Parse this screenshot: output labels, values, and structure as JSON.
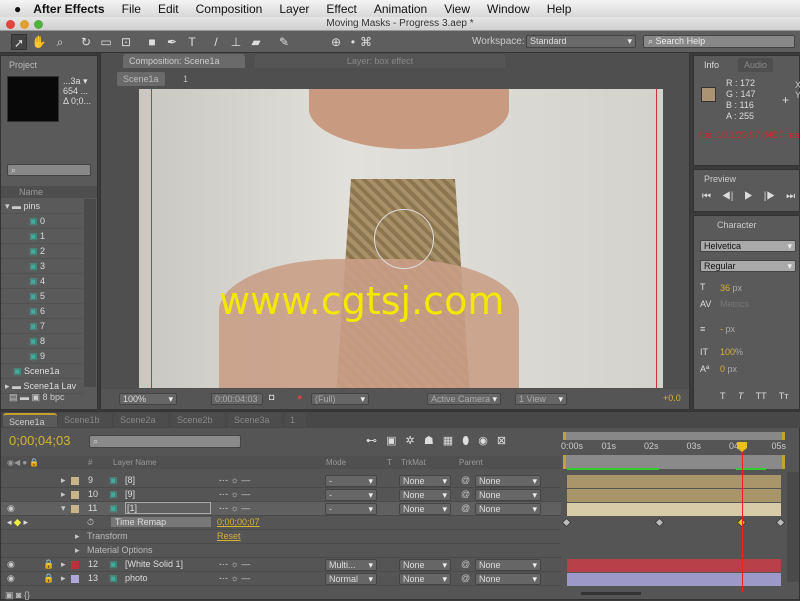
{
  "menubar": {
    "app": "After Effects",
    "items": [
      "File",
      "Edit",
      "Composition",
      "Layer",
      "Effect",
      "Animation",
      "View",
      "Window",
      "Help"
    ]
  },
  "window_title": "Moving Masks - Progress 3.aep *",
  "toolbar": {
    "workspace_label": "Workspace:",
    "workspace_value": "Standard",
    "search_placeholder": "Search Help"
  },
  "project": {
    "tab": "Project",
    "thumb_info": [
      "...3a ▾",
      "654 ...",
      "Δ 0;0..."
    ],
    "column": "Name",
    "items": [
      {
        "name": "pins",
        "type": "folder"
      },
      {
        "name": "0"
      },
      {
        "name": "1"
      },
      {
        "name": "2"
      },
      {
        "name": "3"
      },
      {
        "name": "4"
      },
      {
        "name": "5"
      },
      {
        "name": "6"
      },
      {
        "name": "7"
      },
      {
        "name": "8"
      },
      {
        "name": "9"
      },
      {
        "name": "Scene1a",
        "type": "comp"
      },
      {
        "name": "Scene1a Lav",
        "type": "folder"
      }
    ],
    "bpc": "8 bpc"
  },
  "composition": {
    "tab": "Composition: Scene1a",
    "layer_tab": "Layer: box effect",
    "breadcrumb": "Scene1a",
    "breadcrumb_next": "1",
    "watermark": "www.cgtsj.com",
    "footer": {
      "zoom": "100%",
      "timecode": "0:00:04:03",
      "resolution": "(Full)",
      "camera": "Active Camera",
      "views": "1 View",
      "exposure": "+0.0"
    }
  },
  "info": {
    "tab": "Info",
    "tab2": "Audio",
    "R": "R : 172",
    "G": "G : 147",
    "B": "B : 116",
    "A": "A : 255",
    "X": "X",
    "Y": "Y",
    "fps": "fps: 10.1/29.97 (NOT realtime)",
    "swatch": "#ac9374"
  },
  "preview": {
    "tab": "Preview"
  },
  "character": {
    "tab": "Character",
    "font": "Helvetica",
    "style": "Regular",
    "size": "36",
    "size_unit": "px",
    "kerning": "Metrics",
    "leading": "-",
    "leading_unit": "px",
    "vscale": "100",
    "vscale_unit": "%",
    "baseline": "0",
    "baseline_unit": "px"
  },
  "timeline": {
    "tabs": [
      "Scene1a",
      "Scene1b",
      "Scene2a",
      "Scene2b",
      "Scene3a",
      "1"
    ],
    "timecode": "0;00;04;03",
    "headers": {
      "num": "#",
      "layer_name": "Layer Name",
      "mode": "Mode",
      "t": "T",
      "trkmat": "TrkMat",
      "parent": "Parent"
    },
    "layers": [
      {
        "num": "9",
        "name": "[8]",
        "mode": "-",
        "trkmat": "None",
        "parent": "None",
        "color": "#c8b48a"
      },
      {
        "num": "10",
        "name": "[9]",
        "mode": "-",
        "trkmat": "None",
        "parent": "None",
        "color": "#c8b48a"
      },
      {
        "num": "11",
        "name": "[1]",
        "mode": "-",
        "trkmat": "None",
        "parent": "None",
        "color": "#c8b48a"
      }
    ],
    "property": {
      "name": "Time Remap",
      "value": "0;00;00;07"
    },
    "groups": [
      {
        "name": "Transform",
        "value": "Reset"
      },
      {
        "name": "Material Options"
      }
    ],
    "layers2": [
      {
        "num": "12",
        "name": "[White Solid 1]",
        "mode": "Multi...",
        "trkmat": "None",
        "parent": "None",
        "color": "#c0303a"
      },
      {
        "num": "13",
        "name": "photo",
        "mode": "Normal",
        "trkmat": "None",
        "parent": "None",
        "color": "#b0a8d8"
      }
    ],
    "ruler": [
      "0:00s",
      "01s",
      "02s",
      "03s",
      "04s",
      "05s"
    ]
  }
}
